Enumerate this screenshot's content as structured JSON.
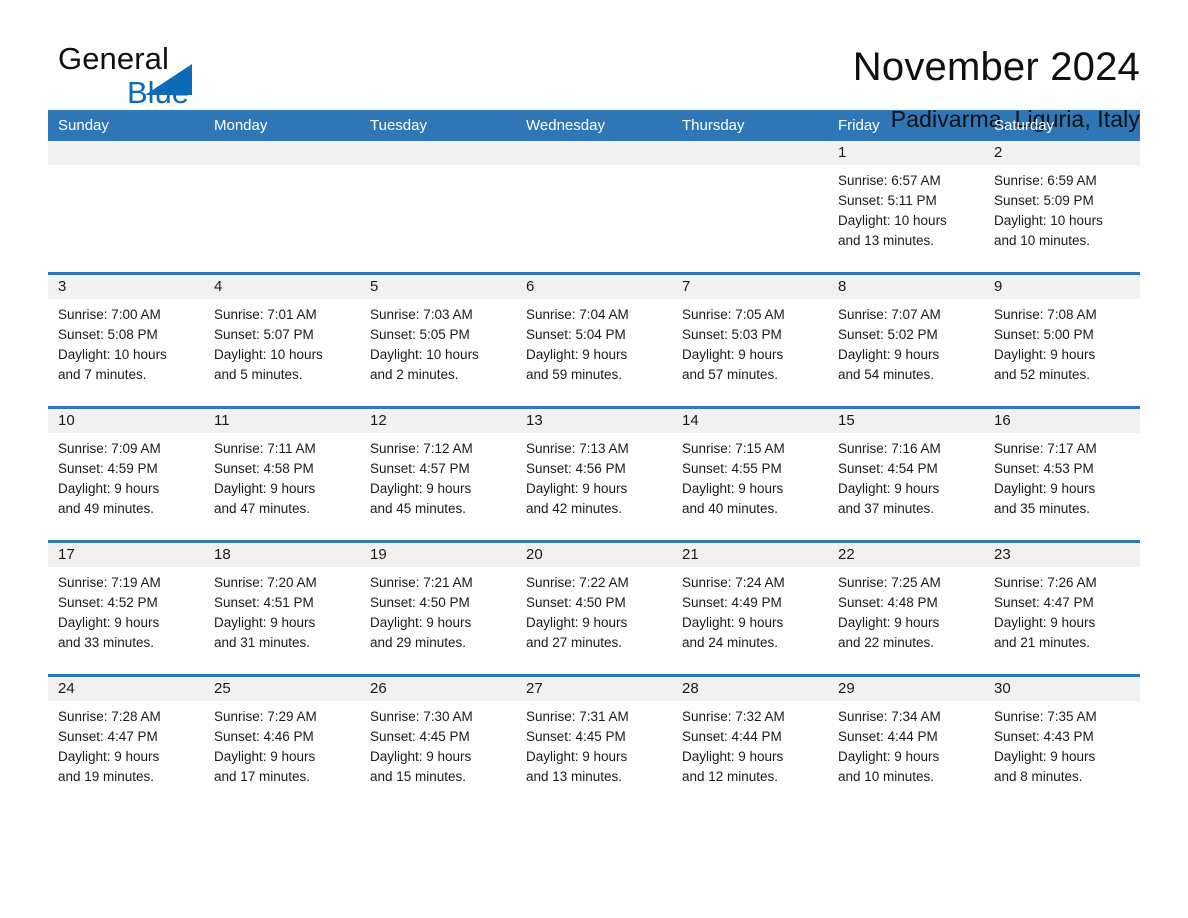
{
  "brand": {
    "line1": "General",
    "line2": "Blue",
    "mark": "triangle-logo"
  },
  "header": {
    "title": "November 2024",
    "subtitle": "Padivarma, Liguria, Italy"
  },
  "calendar": {
    "weekdays": [
      "Sunday",
      "Monday",
      "Tuesday",
      "Wednesday",
      "Thursday",
      "Friday",
      "Saturday"
    ],
    "accent_color": "#2f76b7",
    "band_color": "#f1f1f1",
    "weeks": [
      [
        {
          "day": "",
          "lines": []
        },
        {
          "day": "",
          "lines": []
        },
        {
          "day": "",
          "lines": []
        },
        {
          "day": "",
          "lines": []
        },
        {
          "day": "",
          "lines": []
        },
        {
          "day": "1",
          "lines": [
            "Sunrise: 6:57 AM",
            "Sunset: 5:11 PM",
            "Daylight: 10 hours",
            "and 13 minutes."
          ]
        },
        {
          "day": "2",
          "lines": [
            "Sunrise: 6:59 AM",
            "Sunset: 5:09 PM",
            "Daylight: 10 hours",
            "and 10 minutes."
          ]
        }
      ],
      [
        {
          "day": "3",
          "lines": [
            "Sunrise: 7:00 AM",
            "Sunset: 5:08 PM",
            "Daylight: 10 hours",
            "and 7 minutes."
          ]
        },
        {
          "day": "4",
          "lines": [
            "Sunrise: 7:01 AM",
            "Sunset: 5:07 PM",
            "Daylight: 10 hours",
            "and 5 minutes."
          ]
        },
        {
          "day": "5",
          "lines": [
            "Sunrise: 7:03 AM",
            "Sunset: 5:05 PM",
            "Daylight: 10 hours",
            "and 2 minutes."
          ]
        },
        {
          "day": "6",
          "lines": [
            "Sunrise: 7:04 AM",
            "Sunset: 5:04 PM",
            "Daylight: 9 hours",
            "and 59 minutes."
          ]
        },
        {
          "day": "7",
          "lines": [
            "Sunrise: 7:05 AM",
            "Sunset: 5:03 PM",
            "Daylight: 9 hours",
            "and 57 minutes."
          ]
        },
        {
          "day": "8",
          "lines": [
            "Sunrise: 7:07 AM",
            "Sunset: 5:02 PM",
            "Daylight: 9 hours",
            "and 54 minutes."
          ]
        },
        {
          "day": "9",
          "lines": [
            "Sunrise: 7:08 AM",
            "Sunset: 5:00 PM",
            "Daylight: 9 hours",
            "and 52 minutes."
          ]
        }
      ],
      [
        {
          "day": "10",
          "lines": [
            "Sunrise: 7:09 AM",
            "Sunset: 4:59 PM",
            "Daylight: 9 hours",
            "and 49 minutes."
          ]
        },
        {
          "day": "11",
          "lines": [
            "Sunrise: 7:11 AM",
            "Sunset: 4:58 PM",
            "Daylight: 9 hours",
            "and 47 minutes."
          ]
        },
        {
          "day": "12",
          "lines": [
            "Sunrise: 7:12 AM",
            "Sunset: 4:57 PM",
            "Daylight: 9 hours",
            "and 45 minutes."
          ]
        },
        {
          "day": "13",
          "lines": [
            "Sunrise: 7:13 AM",
            "Sunset: 4:56 PM",
            "Daylight: 9 hours",
            "and 42 minutes."
          ]
        },
        {
          "day": "14",
          "lines": [
            "Sunrise: 7:15 AM",
            "Sunset: 4:55 PM",
            "Daylight: 9 hours",
            "and 40 minutes."
          ]
        },
        {
          "day": "15",
          "lines": [
            "Sunrise: 7:16 AM",
            "Sunset: 4:54 PM",
            "Daylight: 9 hours",
            "and 37 minutes."
          ]
        },
        {
          "day": "16",
          "lines": [
            "Sunrise: 7:17 AM",
            "Sunset: 4:53 PM",
            "Daylight: 9 hours",
            "and 35 minutes."
          ]
        }
      ],
      [
        {
          "day": "17",
          "lines": [
            "Sunrise: 7:19 AM",
            "Sunset: 4:52 PM",
            "Daylight: 9 hours",
            "and 33 minutes."
          ]
        },
        {
          "day": "18",
          "lines": [
            "Sunrise: 7:20 AM",
            "Sunset: 4:51 PM",
            "Daylight: 9 hours",
            "and 31 minutes."
          ]
        },
        {
          "day": "19",
          "lines": [
            "Sunrise: 7:21 AM",
            "Sunset: 4:50 PM",
            "Daylight: 9 hours",
            "and 29 minutes."
          ]
        },
        {
          "day": "20",
          "lines": [
            "Sunrise: 7:22 AM",
            "Sunset: 4:50 PM",
            "Daylight: 9 hours",
            "and 27 minutes."
          ]
        },
        {
          "day": "21",
          "lines": [
            "Sunrise: 7:24 AM",
            "Sunset: 4:49 PM",
            "Daylight: 9 hours",
            "and 24 minutes."
          ]
        },
        {
          "day": "22",
          "lines": [
            "Sunrise: 7:25 AM",
            "Sunset: 4:48 PM",
            "Daylight: 9 hours",
            "and 22 minutes."
          ]
        },
        {
          "day": "23",
          "lines": [
            "Sunrise: 7:26 AM",
            "Sunset: 4:47 PM",
            "Daylight: 9 hours",
            "and 21 minutes."
          ]
        }
      ],
      [
        {
          "day": "24",
          "lines": [
            "Sunrise: 7:28 AM",
            "Sunset: 4:47 PM",
            "Daylight: 9 hours",
            "and 19 minutes."
          ]
        },
        {
          "day": "25",
          "lines": [
            "Sunrise: 7:29 AM",
            "Sunset: 4:46 PM",
            "Daylight: 9 hours",
            "and 17 minutes."
          ]
        },
        {
          "day": "26",
          "lines": [
            "Sunrise: 7:30 AM",
            "Sunset: 4:45 PM",
            "Daylight: 9 hours",
            "and 15 minutes."
          ]
        },
        {
          "day": "27",
          "lines": [
            "Sunrise: 7:31 AM",
            "Sunset: 4:45 PM",
            "Daylight: 9 hours",
            "and 13 minutes."
          ]
        },
        {
          "day": "28",
          "lines": [
            "Sunrise: 7:32 AM",
            "Sunset: 4:44 PM",
            "Daylight: 9 hours",
            "and 12 minutes."
          ]
        },
        {
          "day": "29",
          "lines": [
            "Sunrise: 7:34 AM",
            "Sunset: 4:44 PM",
            "Daylight: 9 hours",
            "and 10 minutes."
          ]
        },
        {
          "day": "30",
          "lines": [
            "Sunrise: 7:35 AM",
            "Sunset: 4:43 PM",
            "Daylight: 9 hours",
            "and 8 minutes."
          ]
        }
      ]
    ]
  }
}
